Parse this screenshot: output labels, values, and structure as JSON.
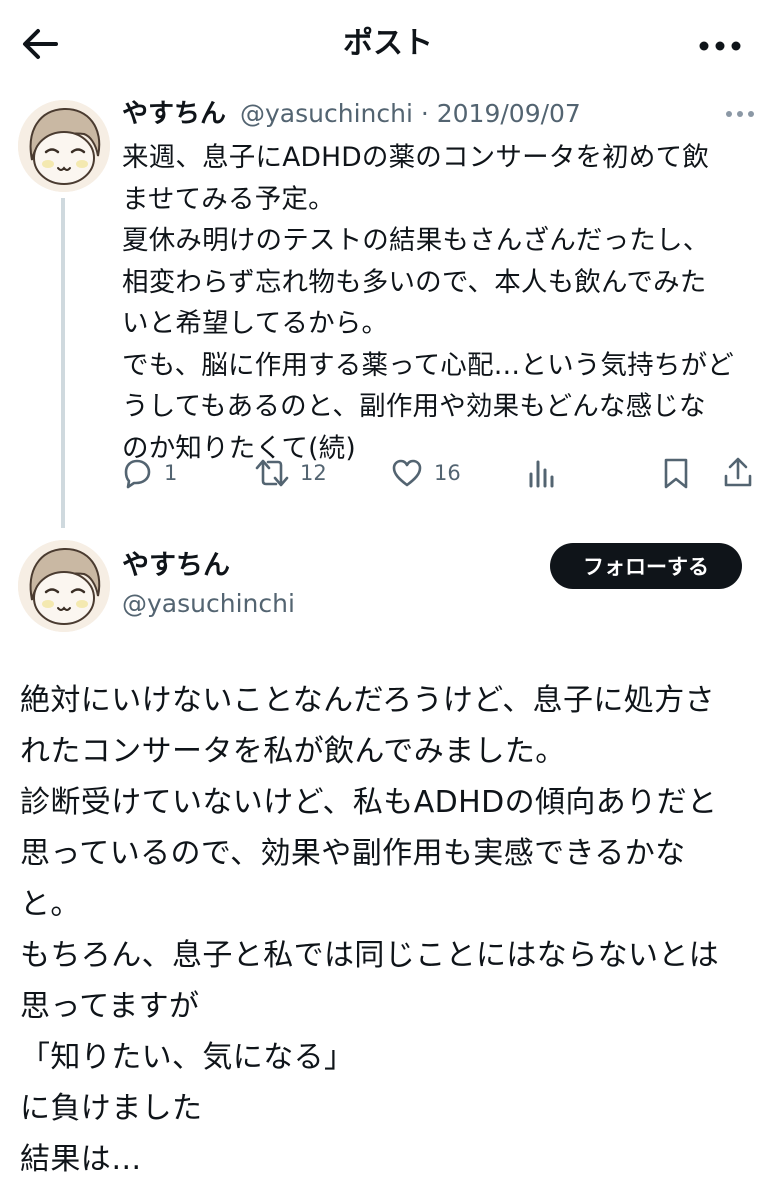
{
  "header": {
    "title": "ポスト"
  },
  "first_post": {
    "display_name": "やすちん",
    "meta": "@yasuchinchi · 2019/09/07",
    "text": "来週、息子にADHDの薬のコンサータを初めて飲\nませてみる予定。\n夏休み明けのテストの結果もさんざんだったし、\n相変わらず忘れ物も多いので、本人も飲んでみた\nいと希望してるから。\nでも、脳に作用する薬って心配…という気持ちがど\nうしてもあるのと、副作用や効果もどんな感じな\nのか知りたくて(続)",
    "actions": {
      "replies": "1",
      "reposts": "12",
      "likes": "16"
    }
  },
  "second_post": {
    "display_name": "やすちん",
    "handle": "@yasuchinchi",
    "follow_label": "フォローする",
    "text": "絶対にいけないことなんだろうけど、息子に処方さ\nれたコンサータを私が飲んでみました。\n診断受けていないけど、私もADHDの傾向ありだと\n思っているので、効果や副作用も実感できるかな\nと。\nもちろん、息子と私では同じことにはならないとは\n思ってますが\n「知りたい、気になる」\nに負けました\n結果は…"
  },
  "colors": {
    "text": "#0f1419",
    "secondary_text": "#536471",
    "thread_line": "#cfd9de",
    "follow_button_bg": "#0f1419"
  }
}
